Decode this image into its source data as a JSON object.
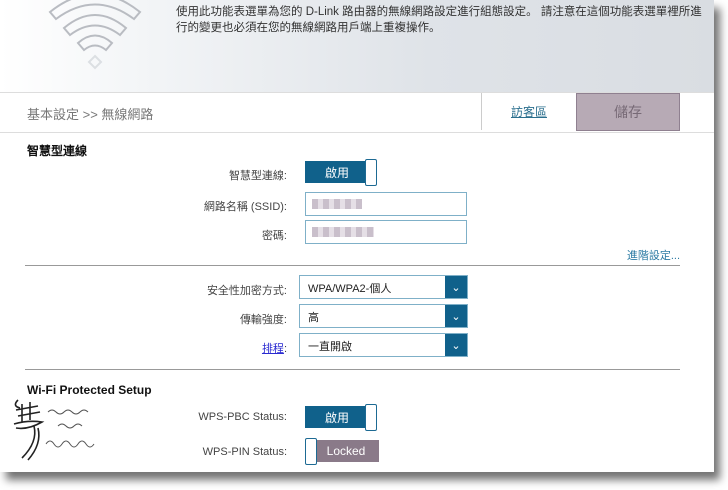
{
  "header": {
    "intro": "使用此功能表選單為您的 D-Link 路由器的無線網路設定進行組態設定。 請注意在這個功能表選單裡所進行的變更也必須在您的無線網路用戶端上重複操作。"
  },
  "nav": {
    "breadcrumb": "基本設定 >> 無線網路",
    "guest_zone": "訪客區",
    "save": "儲存"
  },
  "smart": {
    "title": "智慧型連線",
    "smart_label": "智慧型連線:",
    "smart_state": "啟用",
    "ssid_label": "網路名稱 (SSID):",
    "password_label": "密碼:",
    "advanced": "進階設定..."
  },
  "security": {
    "security_label": "安全性加密方式:",
    "security_value": "WPA/WPA2-個人",
    "power_label": "傳輸強度:",
    "power_value": "高",
    "schedule_label": "排程",
    "schedule_colon": ":",
    "schedule_value": "一直開啟"
  },
  "wps": {
    "title": "Wi-Fi Protected Setup",
    "pbc_label": "WPS-PBC Status:",
    "pbc_state": "啟用",
    "pin_label": "WPS-PIN Status:",
    "pin_state": "Locked"
  },
  "colors": {
    "accent": "#10618b",
    "save_bg": "#b7aab5",
    "locked_bg": "#8a7a89"
  }
}
